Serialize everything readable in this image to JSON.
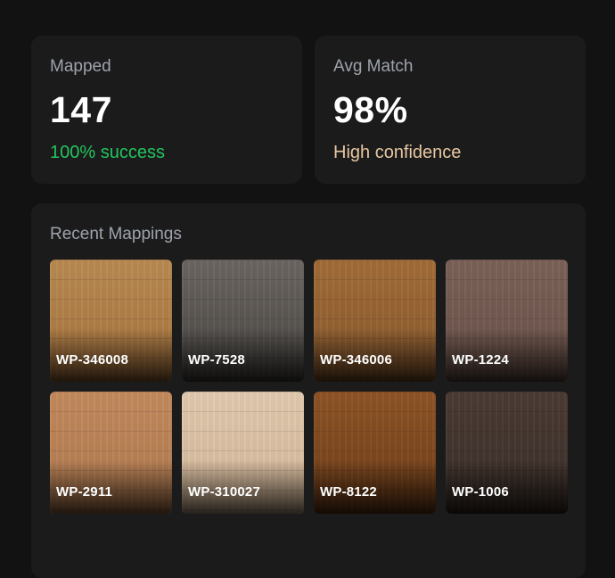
{
  "stats": {
    "mapped": {
      "label": "Mapped",
      "value": "147",
      "sub": "100% success",
      "sub_color": "#22c55e"
    },
    "avg_match": {
      "label": "Avg Match",
      "value": "98%",
      "sub": "High confidence",
      "sub_color": "#e8c7a0"
    }
  },
  "recent": {
    "title": "Recent Mappings",
    "items": [
      {
        "code": "WP-346008",
        "color_top": "#b98a52",
        "color_bottom": "#a8743e"
      },
      {
        "code": "WP-7528",
        "color_top": "#6b6661",
        "color_bottom": "#4a4643"
      },
      {
        "code": "WP-346006",
        "color_top": "#a26c38",
        "color_bottom": "#8a5a2e"
      },
      {
        "code": "WP-1224",
        "color_top": "#7b6259",
        "color_bottom": "#6a5249"
      },
      {
        "code": "WP-2911",
        "color_top": "#c48a5e",
        "color_bottom": "#b07a4f"
      },
      {
        "code": "WP-310027",
        "color_top": "#e2cab0",
        "color_bottom": "#d4b797"
      },
      {
        "code": "WP-8122",
        "color_top": "#8e5426",
        "color_bottom": "#6e3d18"
      },
      {
        "code": "WP-1006",
        "color_top": "#4b3c34",
        "color_bottom": "#3a2e28"
      }
    ]
  }
}
